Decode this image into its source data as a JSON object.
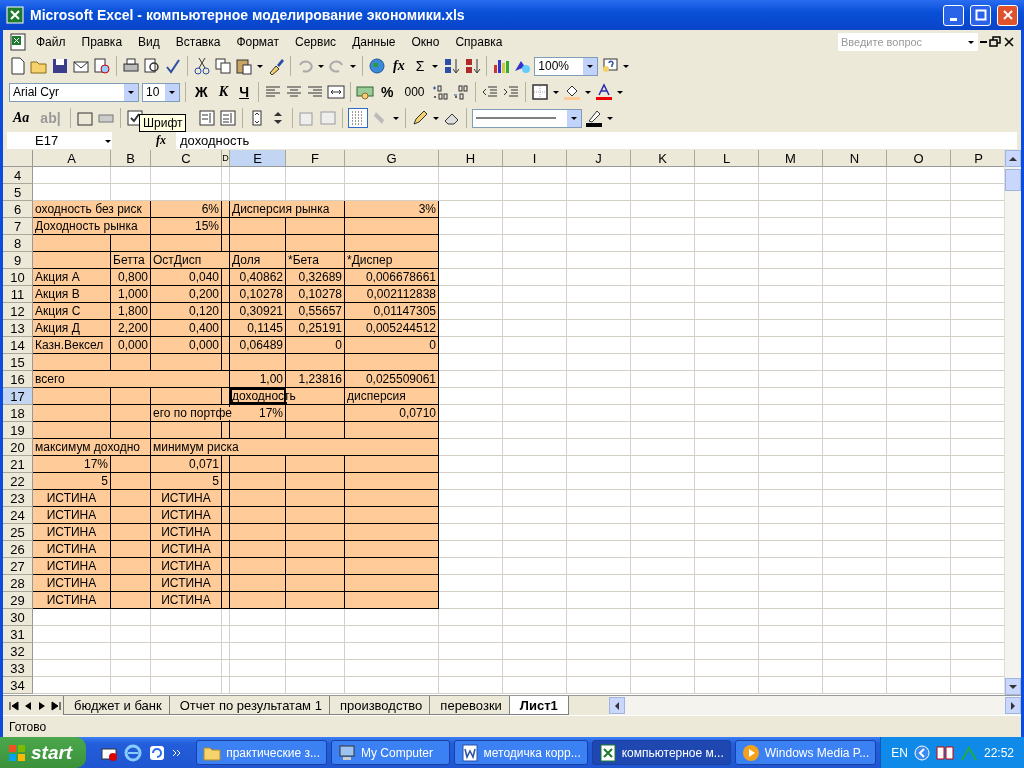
{
  "window": {
    "title": "Microsoft Excel - компьютерное моделирование экономики.xls"
  },
  "menu": [
    {
      "label": "Файл"
    },
    {
      "label": "Правка"
    },
    {
      "label": "Вид"
    },
    {
      "label": "Вставка"
    },
    {
      "label": "Формат"
    },
    {
      "label": "Сервис"
    },
    {
      "label": "Данные"
    },
    {
      "label": "Окно"
    },
    {
      "label": "Справка"
    }
  ],
  "help_search": {
    "placeholder": "Введите вопрос"
  },
  "standard_toolbar": {
    "sum": "Σ",
    "function": "fx",
    "zoom": "100%"
  },
  "formatting_toolbar": {
    "font": "Arial Cyr",
    "size": "10",
    "bold": "Ж",
    "italic": "К",
    "underline": "Ч",
    "percent": "%",
    "thousands": "000"
  },
  "forms_toolbar": {
    "label_tool": "Aa",
    "edit_box": "ab|",
    "tooltip": "Шрифт"
  },
  "formula_bar": {
    "name_box": "E17",
    "fx": "fx",
    "value": "доходность"
  },
  "columns": [
    {
      "label": "A",
      "selected": false,
      "shaded": true
    },
    {
      "label": "B",
      "selected": false,
      "shaded": true
    },
    {
      "label": "C",
      "selected": false,
      "shaded": true
    },
    {
      "label": "D",
      "selected": false,
      "shaded": true
    },
    {
      "label": "E",
      "selected": true,
      "shaded": true
    },
    {
      "label": "F",
      "selected": false,
      "shaded": true
    },
    {
      "label": "G",
      "selected": false,
      "shaded": true
    },
    {
      "label": "H",
      "selected": false,
      "shaded": false
    },
    {
      "label": "I",
      "selected": false,
      "shaded": false
    },
    {
      "label": "J",
      "selected": false,
      "shaded": false
    },
    {
      "label": "K",
      "selected": false,
      "shaded": false
    },
    {
      "label": "L",
      "selected": false,
      "shaded": false
    },
    {
      "label": "M",
      "selected": false,
      "shaded": false
    },
    {
      "label": "N",
      "selected": false,
      "shaded": false
    },
    {
      "label": "O",
      "selected": false,
      "shaded": false
    },
    {
      "label": "P",
      "selected": false,
      "shaded": false
    }
  ],
  "rows": [
    {
      "number": "4",
      "selected": false,
      "shaded": false
    },
    {
      "number": "5",
      "selected": false,
      "shaded": false
    },
    {
      "number": "6",
      "selected": false,
      "shaded": true,
      "cells": [
        {
          "value": "оходность без риск",
          "kind": "text"
        },
        null,
        {
          "value": "6%",
          "kind": "number"
        },
        null,
        {
          "value": "Дисперсия рынка",
          "kind": "text"
        },
        null,
        {
          "value": "3%",
          "kind": "number"
        }
      ]
    },
    {
      "number": "7",
      "selected": false,
      "shaded": true,
      "cells": [
        {
          "value": "Доходность рынка",
          "kind": "text"
        },
        null,
        {
          "value": "15%",
          "kind": "number"
        }
      ]
    },
    {
      "number": "8",
      "selected": false,
      "shaded": true
    },
    {
      "number": "9",
      "selected": false,
      "shaded": true,
      "cells": [
        null,
        {
          "value": "Бетта",
          "kind": "text"
        },
        {
          "value": "ОстДисп",
          "kind": "text"
        },
        null,
        {
          "value": "Доля",
          "kind": "text"
        },
        {
          "value": "*Бета",
          "kind": "text"
        },
        {
          "value": "*Диспер",
          "kind": "text"
        }
      ]
    },
    {
      "number": "10",
      "selected": false,
      "shaded": true,
      "cells": [
        {
          "value": "Акция А",
          "kind": "text"
        },
        {
          "value": "0,800",
          "kind": "number"
        },
        {
          "value": "0,040",
          "kind": "number"
        },
        null,
        {
          "value": "0,40862",
          "kind": "number"
        },
        {
          "value": "0,32689",
          "kind": "number"
        },
        {
          "value": "0,006678661",
          "kind": "number"
        }
      ]
    },
    {
      "number": "11",
      "selected": false,
      "shaded": true,
      "cells": [
        {
          "value": "Акция В",
          "kind": "text"
        },
        {
          "value": "1,000",
          "kind": "number"
        },
        {
          "value": "0,200",
          "kind": "number"
        },
        null,
        {
          "value": "0,10278",
          "kind": "number"
        },
        {
          "value": "0,10278",
          "kind": "number"
        },
        {
          "value": "0,002112838",
          "kind": "number"
        }
      ]
    },
    {
      "number": "12",
      "selected": false,
      "shaded": true,
      "cells": [
        {
          "value": "Акция С",
          "kind": "text"
        },
        {
          "value": "1,800",
          "kind": "number"
        },
        {
          "value": "0,120",
          "kind": "number"
        },
        null,
        {
          "value": "0,30921",
          "kind": "number"
        },
        {
          "value": "0,55657",
          "kind": "number"
        },
        {
          "value": "0,01147305",
          "kind": "number"
        }
      ]
    },
    {
      "number": "13",
      "selected": false,
      "shaded": true,
      "cells": [
        {
          "value": "Акция Д",
          "kind": "text"
        },
        {
          "value": "2,200",
          "kind": "number"
        },
        {
          "value": "0,400",
          "kind": "number"
        },
        null,
        {
          "value": "0,1145",
          "kind": "number"
        },
        {
          "value": "0,25191",
          "kind": "number"
        },
        {
          "value": "0,005244512",
          "kind": "number"
        }
      ]
    },
    {
      "number": "14",
      "selected": false,
      "shaded": true,
      "cells": [
        {
          "value": "Казн.Вексел",
          "kind": "text"
        },
        {
          "value": "0,000",
          "kind": "number"
        },
        {
          "value": "0,000",
          "kind": "number"
        },
        null,
        {
          "value": "0,06489",
          "kind": "number"
        },
        {
          "value": "0",
          "kind": "number"
        },
        {
          "value": "0",
          "kind": "number"
        }
      ]
    },
    {
      "number": "15",
      "selected": false,
      "shaded": true
    },
    {
      "number": "16",
      "selected": false,
      "shaded": true,
      "cells": [
        {
          "value": "всего",
          "kind": "text"
        },
        null,
        null,
        null,
        {
          "value": "1,00",
          "kind": "number"
        },
        {
          "value": "1,23816",
          "kind": "number"
        },
        {
          "value": "0,025509061",
          "kind": "number"
        }
      ]
    },
    {
      "number": "17",
      "selected": true,
      "shaded": true,
      "cells": [
        null,
        null,
        null,
        null,
        {
          "value": "доходность",
          "kind": "text"
        },
        null,
        {
          "value": "дисперсия",
          "kind": "text"
        }
      ]
    },
    {
      "number": "18",
      "selected": false,
      "shaded": true,
      "cells": [
        null,
        null,
        {
          "value": "его по портфе",
          "kind": "text"
        },
        null,
        {
          "value": "17%",
          "kind": "number"
        },
        null,
        {
          "value": "0,0710",
          "kind": "number"
        }
      ]
    },
    {
      "number": "19",
      "selected": false,
      "shaded": true
    },
    {
      "number": "20",
      "selected": false,
      "shaded": true,
      "cells": [
        {
          "value": "максимум доходно",
          "kind": "text"
        },
        null,
        {
          "value": "минимум риска",
          "kind": "text"
        }
      ]
    },
    {
      "number": "21",
      "selected": false,
      "shaded": true,
      "cells": [
        {
          "value": "17%",
          "kind": "number"
        },
        null,
        {
          "value": "0,071",
          "kind": "number"
        }
      ]
    },
    {
      "number": "22",
      "selected": false,
      "shaded": true,
      "cells": [
        {
          "value": "5",
          "kind": "number"
        },
        null,
        {
          "value": "5",
          "kind": "number"
        }
      ]
    },
    {
      "number": "23",
      "selected": false,
      "shaded": true,
      "cells": [
        {
          "value": "ИСТИНА",
          "kind": "boolean"
        },
        null,
        {
          "value": "ИСТИНА",
          "kind": "boolean"
        }
      ]
    },
    {
      "number": "24",
      "selected": false,
      "shaded": true,
      "cells": [
        {
          "value": "ИСТИНА",
          "kind": "boolean"
        },
        null,
        {
          "value": "ИСТИНА",
          "kind": "boolean"
        }
      ]
    },
    {
      "number": "25",
      "selected": false,
      "shaded": true,
      "cells": [
        {
          "value": "ИСТИНА",
          "kind": "boolean"
        },
        null,
        {
          "value": "ИСТИНА",
          "kind": "boolean"
        }
      ]
    },
    {
      "number": "26",
      "selected": false,
      "shaded": true,
      "cells": [
        {
          "value": "ИСТИНА",
          "kind": "boolean"
        },
        null,
        {
          "value": "ИСТИНА",
          "kind": "boolean"
        }
      ]
    },
    {
      "number": "27",
      "selected": false,
      "shaded": true,
      "cells": [
        {
          "value": "ИСТИНА",
          "kind": "boolean"
        },
        null,
        {
          "value": "ИСТИНА",
          "kind": "boolean"
        }
      ]
    },
    {
      "number": "28",
      "selected": false,
      "shaded": true,
      "cells": [
        {
          "value": "ИСТИНА",
          "kind": "boolean"
        },
        null,
        {
          "value": "ИСТИНА",
          "kind": "boolean"
        }
      ]
    },
    {
      "number": "29",
      "selected": false,
      "shaded": true,
      "cells": [
        {
          "value": "ИСТИНА",
          "kind": "boolean"
        },
        null,
        {
          "value": "ИСТИНА",
          "kind": "boolean"
        }
      ]
    },
    {
      "number": "30",
      "selected": false,
      "shaded": false
    },
    {
      "number": "31",
      "selected": false,
      "shaded": false
    },
    {
      "number": "32",
      "selected": false,
      "shaded": false
    },
    {
      "number": "33",
      "selected": false,
      "shaded": false
    },
    {
      "number": "34",
      "selected": false,
      "shaded": false
    }
  ],
  "sheet_tabs": [
    {
      "label": "бюджет и банк",
      "selected": false
    },
    {
      "label": "Отчет по результатам 1",
      "selected": false
    },
    {
      "label": "производство",
      "selected": false
    },
    {
      "label": "перевозки",
      "selected": false
    },
    {
      "label": "Лист1",
      "selected": true
    }
  ],
  "status_bar": "Готово",
  "taskbar": {
    "start": "start",
    "tasks": [
      {
        "label": "практические з...",
        "kind": "folder",
        "selected": false
      },
      {
        "label": "My Computer",
        "kind": "computer",
        "selected": false
      },
      {
        "label": "методичка корр...",
        "kind": "word",
        "selected": false
      },
      {
        "label": "компьютерное м...",
        "kind": "excel",
        "selected": true
      },
      {
        "label": "Windows Media P...",
        "kind": "media",
        "selected": false
      }
    ],
    "language": "EN",
    "clock": "22:52"
  }
}
